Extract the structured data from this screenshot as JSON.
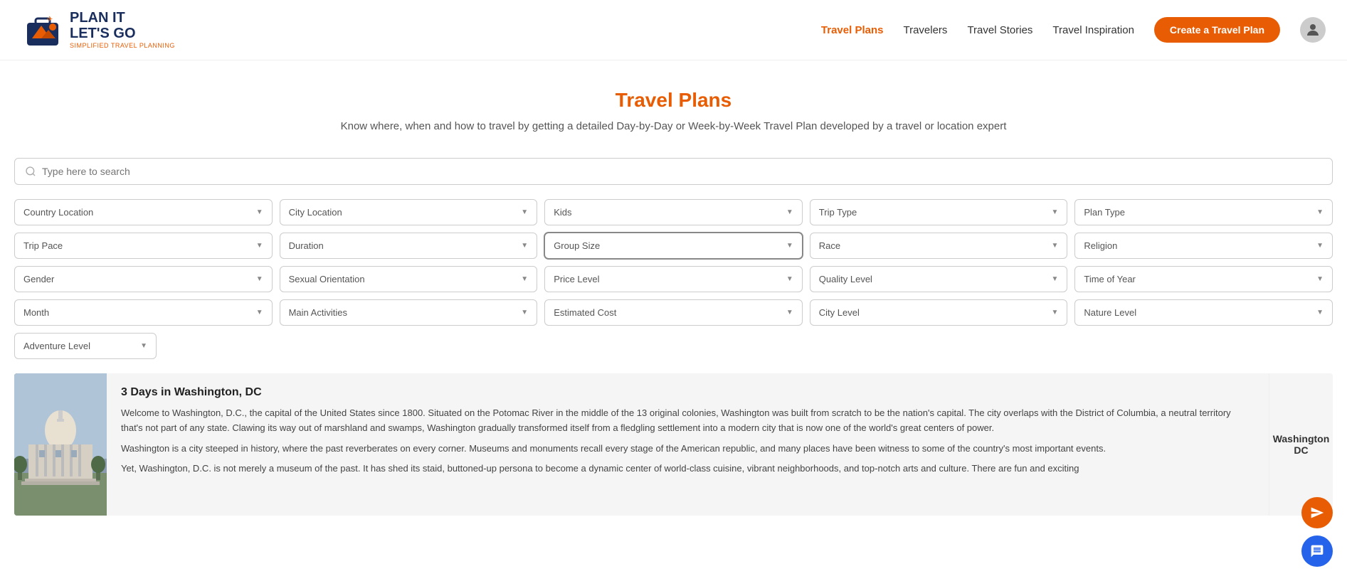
{
  "header": {
    "logo": {
      "line1": "PLAN IT",
      "line2": "LET'S GO",
      "subtitle": "SIMPLIFIED TRAVEL PLANNING"
    },
    "nav": [
      {
        "label": "Travel Plans",
        "active": true
      },
      {
        "label": "Travelers",
        "active": false
      },
      {
        "label": "Travel Stories",
        "active": false
      },
      {
        "label": "Travel Inspiration",
        "active": false
      }
    ],
    "create_btn": "Create a Travel Plan"
  },
  "hero": {
    "title": "Travel Plans",
    "subtitle": "Know where, when and how to travel by getting a detailed Day-by-Day or Week-by-Week Travel Plan developed by a travel or location expert"
  },
  "search": {
    "placeholder": "Type here to search"
  },
  "filters": {
    "row1": [
      {
        "label": "Country Location",
        "id": "country-location"
      },
      {
        "label": "City Location",
        "id": "city-location"
      },
      {
        "label": "Kids",
        "id": "kids"
      },
      {
        "label": "Trip Type",
        "id": "trip-type"
      },
      {
        "label": "Plan Type",
        "id": "plan-type"
      }
    ],
    "row2": [
      {
        "label": "Trip Pace",
        "id": "trip-pace"
      },
      {
        "label": "Duration",
        "id": "duration"
      },
      {
        "label": "Group Size",
        "id": "group-size",
        "highlighted": true
      },
      {
        "label": "Race",
        "id": "race"
      },
      {
        "label": "Religion",
        "id": "religion"
      }
    ],
    "row3": [
      {
        "label": "Gender",
        "id": "gender"
      },
      {
        "label": "Sexual Orientation",
        "id": "sexual-orientation"
      },
      {
        "label": "Price Level",
        "id": "price-level"
      },
      {
        "label": "Quality Level",
        "id": "quality-level"
      },
      {
        "label": "Time of Year",
        "id": "time-of-year"
      }
    ],
    "row4": [
      {
        "label": "Month",
        "id": "month"
      },
      {
        "label": "Main Activities",
        "id": "main-activities"
      },
      {
        "label": "Estimated Cost",
        "id": "estimated-cost"
      },
      {
        "label": "City Level",
        "id": "city-level"
      },
      {
        "label": "Nature Level",
        "id": "nature-level"
      }
    ],
    "row5": [
      {
        "label": "Adventure Level",
        "id": "adventure-level"
      }
    ]
  },
  "result": {
    "title": "3 Days in Washington, DC",
    "location_line1": "Washington",
    "location_line2": "DC",
    "desc1": "Welcome to Washington, D.C., the capital of the United States since 1800. Situated on the Potomac River in the middle of the 13 original colonies, Washington was built from scratch to be the nation's capital. The city overlaps with the District of Columbia, a neutral territory that's not part of any state. Clawing its way out of marshland and swamps, Washington gradually transformed itself from a fledgling settlement into a modern city that is now one of the world's great centers of power.",
    "desc2": "Washington is a city steeped in history, where the past reverberates on every corner. Museums and monuments recall every stage of the American republic, and many places have been witness to some of the country's most important events.",
    "desc3": "Yet, Washington, D.C. is not merely a museum of the past. It has shed its staid, buttoned-up persona to become a dynamic center of world-class cuisine, vibrant neighborhoods, and top-notch arts and culture. There are fun and exciting"
  }
}
